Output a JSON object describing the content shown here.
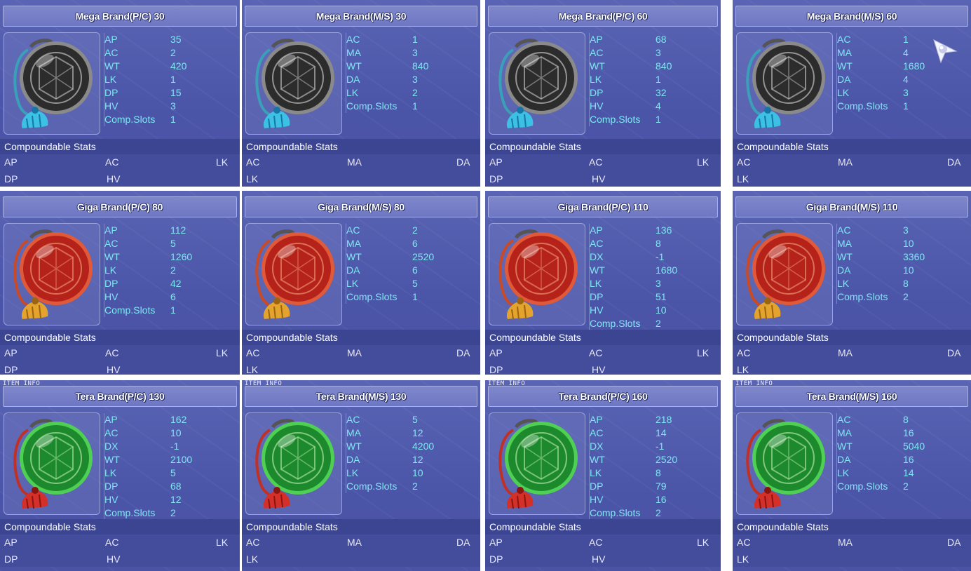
{
  "compound_header": "Compoundable Stats",
  "caption": "ITEM INFO",
  "colors": {
    "mega": {
      "body": "#2c2c2c",
      "rim": "#8a8a8a",
      "hi": "#d8d8d8",
      "tassel": "#3cc0e4",
      "tassel_dark": "#1676a6",
      "cord": "#3aa0b8"
    },
    "giga": {
      "body": "#b52219",
      "rim": "#e05a3a",
      "hi": "#f6a57e",
      "tassel": "#e4a32c",
      "tassel_dark": "#9a6410",
      "cord": "#c84a26"
    },
    "tera": {
      "body": "#1c8a2c",
      "rim": "#4fcf53",
      "hi": "#c4f2b7",
      "tassel": "#d4302a",
      "tassel_dark": "#8a1410",
      "cord": "#c03024"
    }
  },
  "panels": [
    {
      "title": "Mega Brand(P/C) 30",
      "tier": "mega",
      "caption": "",
      "stats": [
        [
          "AP",
          "35"
        ],
        [
          "AC",
          "2"
        ],
        [
          "WT",
          "420"
        ],
        [
          "LK",
          "1"
        ],
        [
          "DP",
          "15"
        ],
        [
          "HV",
          "3"
        ],
        [
          "Comp.Slots",
          "1"
        ]
      ],
      "compound": [
        "AP",
        "AC",
        "LK",
        "DP",
        "HV"
      ]
    },
    {
      "title": "Mega Brand(M/S) 30",
      "tier": "mega",
      "caption": "",
      "stats": [
        [
          "AC",
          "1"
        ],
        [
          "MA",
          "3"
        ],
        [
          "WT",
          "840"
        ],
        [
          "DA",
          "3"
        ],
        [
          "LK",
          "2"
        ],
        [
          "Comp.Slots",
          "1"
        ]
      ],
      "compound": [
        "AC",
        "MA",
        "DA",
        "LK"
      ]
    },
    {
      "title": "Mega Brand(P/C) 60",
      "tier": "mega",
      "caption": "",
      "stats": [
        [
          "AP",
          "68"
        ],
        [
          "AC",
          "3"
        ],
        [
          "WT",
          "840"
        ],
        [
          "LK",
          "1"
        ],
        [
          "DP",
          "32"
        ],
        [
          "HV",
          "4"
        ],
        [
          "Comp.Slots",
          "1"
        ]
      ],
      "compound": [
        "AP",
        "AC",
        "LK",
        "DP",
        "HV"
      ]
    },
    {
      "title": "Mega Brand(M/S) 60",
      "tier": "mega",
      "caption": "",
      "stats": [
        [
          "AC",
          "1"
        ],
        [
          "MA",
          "4"
        ],
        [
          "WT",
          "1680"
        ],
        [
          "DA",
          "4"
        ],
        [
          "LK",
          "3"
        ],
        [
          "Comp.Slots",
          "1"
        ]
      ],
      "compound": [
        "AC",
        "MA",
        "DA",
        "LK"
      ]
    },
    {
      "title": "Giga Brand(P/C) 80",
      "tier": "giga",
      "caption": "",
      "stats": [
        [
          "AP",
          "112"
        ],
        [
          "AC",
          "5"
        ],
        [
          "WT",
          "1260"
        ],
        [
          "LK",
          "2"
        ],
        [
          "DP",
          "42"
        ],
        [
          "HV",
          "6"
        ],
        [
          "Comp.Slots",
          "1"
        ]
      ],
      "compound": [
        "AP",
        "AC",
        "LK",
        "DP",
        "HV"
      ]
    },
    {
      "title": "Giga Brand(M/S) 80",
      "tier": "giga",
      "caption": "",
      "stats": [
        [
          "AC",
          "2"
        ],
        [
          "MA",
          "6"
        ],
        [
          "WT",
          "2520"
        ],
        [
          "DA",
          "6"
        ],
        [
          "LK",
          "5"
        ],
        [
          "Comp.Slots",
          "1"
        ]
      ],
      "compound": [
        "AC",
        "MA",
        "DA",
        "LK"
      ]
    },
    {
      "title": "Giga Brand(P/C) 110",
      "tier": "giga",
      "caption": "",
      "stats": [
        [
          "AP",
          "136"
        ],
        [
          "AC",
          "8"
        ],
        [
          "DX",
          "-1"
        ],
        [
          "WT",
          "1680"
        ],
        [
          "LK",
          "3"
        ],
        [
          "DP",
          "51"
        ],
        [
          "HV",
          "10"
        ],
        [
          "Comp.Slots",
          "2"
        ]
      ],
      "compound": [
        "AP",
        "AC",
        "LK",
        "DP",
        "HV"
      ]
    },
    {
      "title": "Giga Brand(M/S) 110",
      "tier": "giga",
      "caption": "",
      "stats": [
        [
          "AC",
          "3"
        ],
        [
          "MA",
          "10"
        ],
        [
          "WT",
          "3360"
        ],
        [
          "DA",
          "10"
        ],
        [
          "LK",
          "8"
        ],
        [
          "Comp.Slots",
          "2"
        ]
      ],
      "compound": [
        "AC",
        "MA",
        "DA",
        "LK"
      ]
    },
    {
      "title": "Tera Brand(P/C) 130",
      "tier": "tera",
      "caption": "ITEM INFO",
      "stats": [
        [
          "AP",
          "162"
        ],
        [
          "AC",
          "10"
        ],
        [
          "DX",
          "-1"
        ],
        [
          "WT",
          "2100"
        ],
        [
          "LK",
          "5"
        ],
        [
          "DP",
          "68"
        ],
        [
          "HV",
          "12"
        ],
        [
          "Comp.Slots",
          "2"
        ]
      ],
      "compound": [
        "AP",
        "AC",
        "LK",
        "DP",
        "HV"
      ]
    },
    {
      "title": "Tera Brand(M/S) 130",
      "tier": "tera",
      "caption": "ITEM INFO",
      "stats": [
        [
          "AC",
          "5"
        ],
        [
          "MA",
          "12"
        ],
        [
          "WT",
          "4200"
        ],
        [
          "DA",
          "12"
        ],
        [
          "LK",
          "10"
        ],
        [
          "Comp.Slots",
          "2"
        ]
      ],
      "compound": [
        "AC",
        "MA",
        "DA",
        "LK"
      ]
    },
    {
      "title": "Tera Brand(P/C) 160",
      "tier": "tera",
      "caption": "ITEM INFO",
      "stats": [
        [
          "AP",
          "218"
        ],
        [
          "AC",
          "14"
        ],
        [
          "DX",
          "-1"
        ],
        [
          "WT",
          "2520"
        ],
        [
          "LK",
          "8"
        ],
        [
          "DP",
          "79"
        ],
        [
          "HV",
          "16"
        ],
        [
          "Comp.Slots",
          "2"
        ]
      ],
      "compound": [
        "AP",
        "AC",
        "LK",
        "DP",
        "HV"
      ]
    },
    {
      "title": "Tera Brand(M/S) 160",
      "tier": "tera",
      "caption": "ITEM INFO",
      "stats": [
        [
          "AC",
          "8"
        ],
        [
          "MA",
          "16"
        ],
        [
          "WT",
          "5040"
        ],
        [
          "DA",
          "16"
        ],
        [
          "LK",
          "14"
        ],
        [
          "Comp.Slots",
          "2"
        ]
      ],
      "compound": [
        "AC",
        "MA",
        "DA",
        "LK"
      ]
    }
  ]
}
